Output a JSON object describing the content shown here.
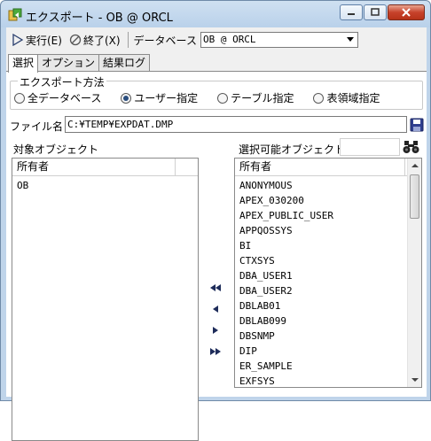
{
  "window": {
    "title": "エクスポート - OB @ ORCL"
  },
  "toolbar": {
    "run_label": "実行(E)",
    "exit_label": "終了(X)",
    "db_label": "データベース",
    "db_value": "OB @ ORCL"
  },
  "tabs": [
    {
      "label": "選択",
      "active": true
    },
    {
      "label": "オプション",
      "active": false
    },
    {
      "label": "結果ログ",
      "active": false
    }
  ],
  "export_method": {
    "title": "エクスポート方法",
    "options": [
      {
        "label": "全データベース",
        "selected": false
      },
      {
        "label": "ユーザー指定",
        "selected": true
      },
      {
        "label": "テーブル指定",
        "selected": false
      },
      {
        "label": "表領域指定",
        "selected": false
      }
    ]
  },
  "file": {
    "label": "ファイル名",
    "value": "C:¥TEMP¥EXPDAT.DMP"
  },
  "target": {
    "label": "対象オブジェクト",
    "column": "所有者",
    "rows": [
      "OB"
    ]
  },
  "available": {
    "label": "選択可能オブジェクト",
    "search_value": "",
    "column": "所有者",
    "rows": [
      "ANONYMOUS",
      "APEX_030200",
      "APEX_PUBLIC_USER",
      "APPQOSSYS",
      "BI",
      "CTXSYS",
      "DBA_USER1",
      "DBA_USER2",
      "DBLAB01",
      "DBLAB099",
      "DBSNMP",
      "DIP",
      "ER_SAMPLE",
      "EXFSYS"
    ]
  },
  "icons": {
    "app": "app-icon",
    "run": "play-icon",
    "exit": "stop-icon",
    "save": "floppy-icon",
    "find": "binoculars-icon",
    "move_all_left": "double-left-arrow-icon",
    "move_left": "left-arrow-icon",
    "move_right": "right-arrow-icon",
    "move_all_right": "double-right-arrow-icon"
  },
  "colors": {
    "title_gradient": "#b9d1ea",
    "radio_dot": "#2a4d7e",
    "close_button": "#c7422b"
  }
}
